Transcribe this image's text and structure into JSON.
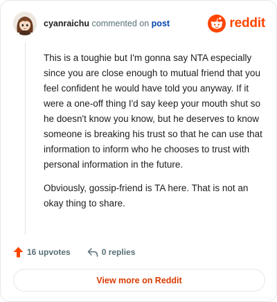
{
  "comment": {
    "username": "cyanraichu",
    "action_text": "commented on",
    "post_link": "post",
    "paragraphs": [
      "This is a toughie but I'm gonna say NTA especially since you are close enough to mutual friend that you feel confident he would have told you anyway. If it were a one-off thing I'd say keep your mouth shut so he doesn't know you know, but he deserves to know someone is breaking his trust so that he can use that information to inform who he chooses to trust with personal information in the future.",
      "Obviously, gossip-friend is TA here. That is not an okay thing to share."
    ]
  },
  "brand": {
    "name": "reddit",
    "color": "#ff4500"
  },
  "actions": {
    "upvotes": "16 upvotes",
    "replies": "0 replies"
  },
  "footer": {
    "view_more": "View more on Reddit"
  },
  "colors": {
    "text": "#1c1c1c",
    "muted": "#576f76",
    "link": "#0045ac",
    "upvote": "#ff4500",
    "cta": "#d93a00"
  },
  "icons": [
    "user-avatar",
    "reddit-logo-icon",
    "upvote-arrow-icon",
    "reply-icon"
  ]
}
